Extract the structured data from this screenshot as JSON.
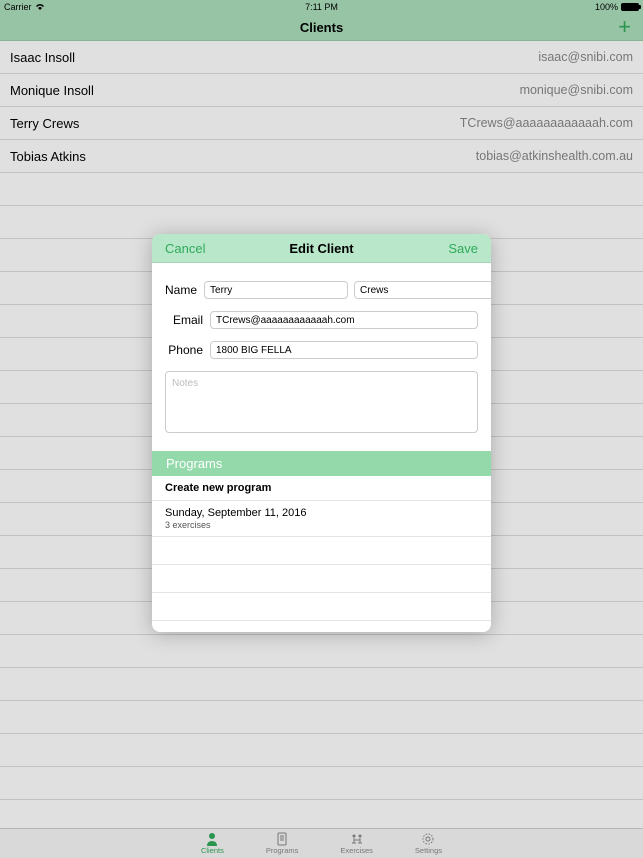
{
  "status": {
    "carrier": "Carrier",
    "time": "7:11 PM",
    "battery": "100%"
  },
  "nav": {
    "title": "Clients"
  },
  "clients": [
    {
      "name": "Isaac Insoll",
      "email": "isaac@snibi.com"
    },
    {
      "name": "Monique Insoll",
      "email": "monique@snibi.com"
    },
    {
      "name": "Terry Crews",
      "email": "TCrews@aaaaaaaaaaaah.com"
    },
    {
      "name": "Tobias Atkins",
      "email": "tobias@atkinshealth.com.au"
    }
  ],
  "modal": {
    "cancel": "Cancel",
    "title": "Edit Client",
    "save": "Save",
    "labels": {
      "name": "Name",
      "email": "Email",
      "phone": "Phone"
    },
    "fields": {
      "first_name": "Terry",
      "last_name": "Crews",
      "email": "TCrews@aaaaaaaaaaaah.com",
      "phone": "1800 BIG FELLA",
      "notes_placeholder": "Notes"
    },
    "programs_header": "Programs",
    "create_program": "Create new program",
    "program_items": [
      {
        "date": "Sunday, September 11, 2016",
        "subtitle": "3 exercises"
      }
    ]
  },
  "tabs": {
    "clients": "Clients",
    "programs": "Programs",
    "exercises": "Exercises",
    "settings": "Settings"
  },
  "colors": {
    "accent": "#2faa5b",
    "light_green": "#aee0be",
    "mid_green": "#93d9a9"
  }
}
